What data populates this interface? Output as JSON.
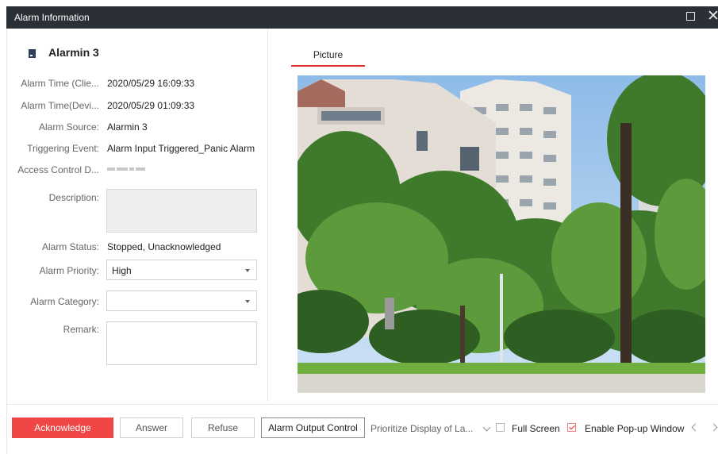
{
  "window": {
    "title": "Alarm Information"
  },
  "alarm": {
    "name": "Alarmin 3",
    "fields": [
      {
        "label": "Alarm Time (Clie...",
        "value": "2020/05/29 16:09:33"
      },
      {
        "label": "Alarm Time(Devi...",
        "value": "2020/05/29 01:09:33"
      },
      {
        "label": "Alarm Source:",
        "value": "Alarmin 3"
      },
      {
        "label": "Triggering Event:",
        "value": "Alarm Input Triggered_Panic Alarm"
      },
      {
        "label": "Access Control D..."
      }
    ],
    "description_label": "Description:",
    "description_value": "",
    "status_label": "Alarm Status:",
    "status_value": "Stopped, Unacknowledged",
    "priority_label": "Alarm Priority:",
    "priority_value": "High",
    "category_label": "Alarm Category:",
    "category_value": "",
    "remark_label": "Remark:",
    "remark_value": ""
  },
  "tabs": {
    "picture_label": "Picture"
  },
  "footer": {
    "acknowledge": "Acknowledge",
    "answer": "Answer",
    "refuse": "Refuse",
    "output_control": "Alarm Output Control",
    "prioritize": "Prioritize Display of La...",
    "full_screen": "Full Screen",
    "full_screen_checked": false,
    "enable_popup": "Enable Pop-up Window",
    "enable_popup_checked": true
  },
  "colors": {
    "accent": "#f04646",
    "titlebar": "#2b2f36"
  },
  "icons": [
    "alarm-input-icon",
    "maximize-icon",
    "close-icon",
    "dropdown-caret-icon",
    "chevron-left-icon",
    "chevron-right-icon"
  ]
}
